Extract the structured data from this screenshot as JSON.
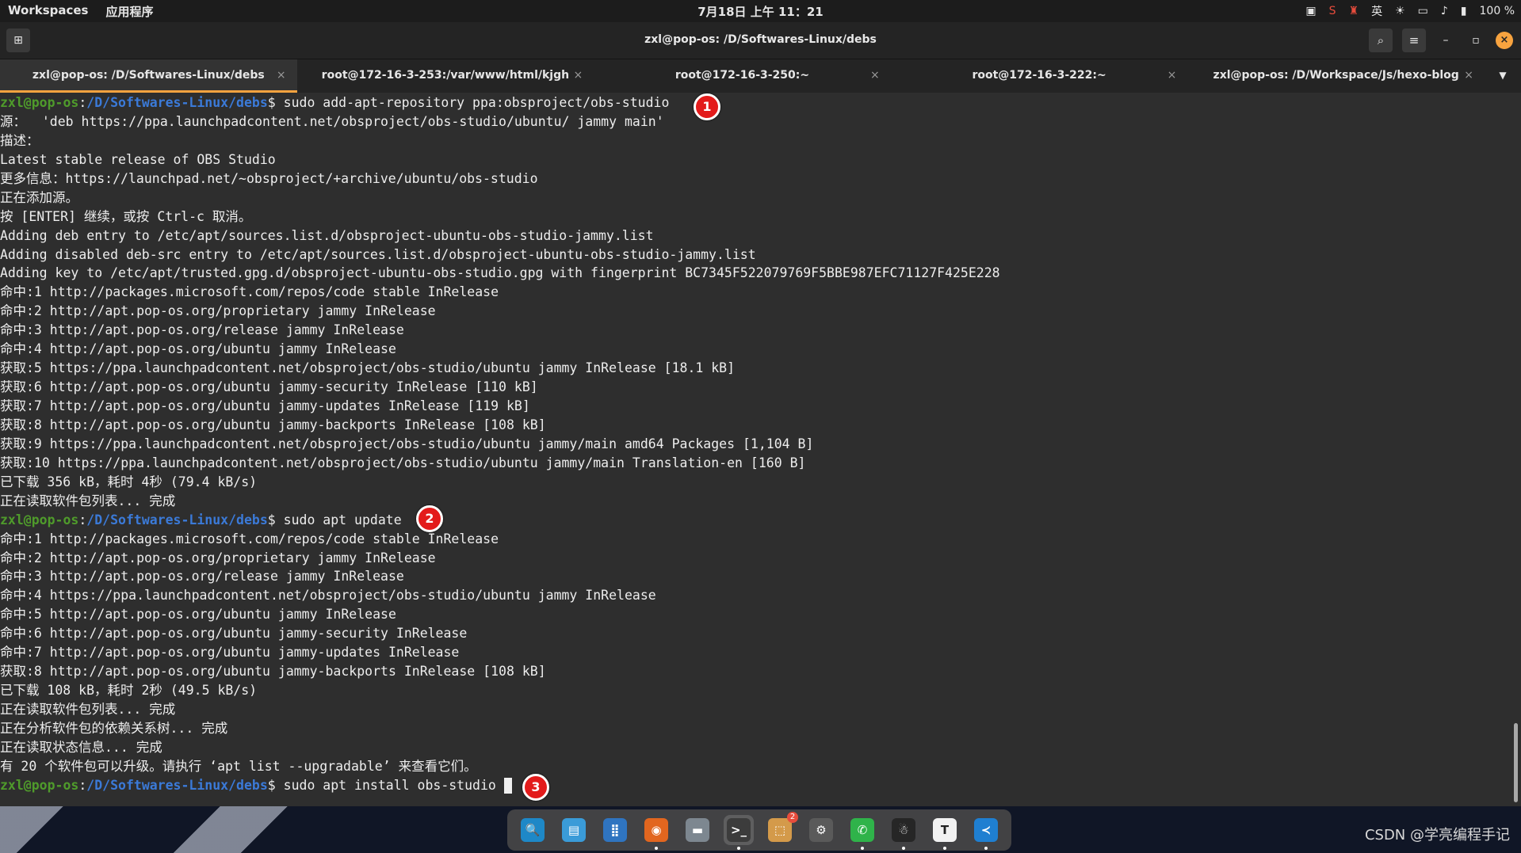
{
  "topbar": {
    "workspaces": "Workspaces",
    "apps": "应用程序",
    "clock": "7月18日 上午 11：21",
    "ime": "英",
    "battery": "100 %"
  },
  "window": {
    "title": "zxl@pop-os: /D/Softwares-Linux/debs"
  },
  "tabs": [
    {
      "label": "zxl@pop-os: /D/Softwares-Linux/debs",
      "active": true
    },
    {
      "label": "root@172-16-3-253:/var/www/html/kjgh",
      "active": false
    },
    {
      "label": "root@172-16-3-250:~",
      "active": false
    },
    {
      "label": "root@172-16-3-222:~",
      "active": false
    },
    {
      "label": "zxl@pop-os: /D/Workspace/Js/hexo-blog",
      "active": false
    }
  ],
  "prompt": {
    "user": "zxl@pop-os",
    "sep": ":",
    "path": "/D/Softwares-Linux/debs",
    "dollar": "$ "
  },
  "terminal": {
    "cmd1": "sudo add-apt-repository ppa:obsproject/obs-studio",
    "out1": [
      "源：  'deb https://ppa.launchpadcontent.net/obsproject/obs-studio/ubuntu/ jammy main'",
      "描述：",
      "Latest stable release of OBS Studio",
      "更多信息：https://launchpad.net/~obsproject/+archive/ubuntu/obs-studio",
      "正在添加源。",
      "按 [ENTER] 继续，或按 Ctrl-c 取消。",
      "Adding deb entry to /etc/apt/sources.list.d/obsproject-ubuntu-obs-studio-jammy.list",
      "Adding disabled deb-src entry to /etc/apt/sources.list.d/obsproject-ubuntu-obs-studio-jammy.list",
      "Adding key to /etc/apt/trusted.gpg.d/obsproject-ubuntu-obs-studio.gpg with fingerprint BC7345F522079769F5BBE987EFC71127F425E228",
      "命中:1 http://packages.microsoft.com/repos/code stable InRelease",
      "命中:2 http://apt.pop-os.org/proprietary jammy InRelease",
      "命中:3 http://apt.pop-os.org/release jammy InRelease",
      "命中:4 http://apt.pop-os.org/ubuntu jammy InRelease",
      "获取:5 https://ppa.launchpadcontent.net/obsproject/obs-studio/ubuntu jammy InRelease [18.1 kB]",
      "获取:6 http://apt.pop-os.org/ubuntu jammy-security InRelease [110 kB]",
      "获取:7 http://apt.pop-os.org/ubuntu jammy-updates InRelease [119 kB]",
      "获取:8 http://apt.pop-os.org/ubuntu jammy-backports InRelease [108 kB]",
      "获取:9 https://ppa.launchpadcontent.net/obsproject/obs-studio/ubuntu jammy/main amd64 Packages [1,104 B]",
      "获取:10 https://ppa.launchpadcontent.net/obsproject/obs-studio/ubuntu jammy/main Translation-en [160 B]",
      "已下载 356 kB，耗时 4秒 (79.4 kB/s)",
      "正在读取软件包列表... 完成"
    ],
    "cmd2": "sudo apt update",
    "out2": [
      "命中:1 http://packages.microsoft.com/repos/code stable InRelease",
      "命中:2 http://apt.pop-os.org/proprietary jammy InRelease",
      "命中:3 http://apt.pop-os.org/release jammy InRelease",
      "命中:4 https://ppa.launchpadcontent.net/obsproject/obs-studio/ubuntu jammy InRelease",
      "命中:5 http://apt.pop-os.org/ubuntu jammy InRelease",
      "命中:6 http://apt.pop-os.org/ubuntu jammy-security InRelease",
      "命中:7 http://apt.pop-os.org/ubuntu jammy-updates InRelease",
      "获取:8 http://apt.pop-os.org/ubuntu jammy-backports InRelease [108 kB]",
      "已下载 108 kB，耗时 2秒 (49.5 kB/s)",
      "正在读取软件包列表... 完成",
      "正在分析软件包的依赖关系树... 完成",
      "正在读取状态信息... 完成",
      "有 20 个软件包可以升级。请执行 ‘apt list --upgradable’ 来查看它们。"
    ],
    "cmd3": "sudo apt install obs-studio "
  },
  "badges": [
    "1",
    "2",
    "3"
  ],
  "dock": {
    "apps": [
      {
        "name": "search-app-icon",
        "glyph": "🔍",
        "bg": "#1e88c7"
      },
      {
        "name": "workspaces-app-icon",
        "glyph": "▤",
        "bg": "#3a9bd8"
      },
      {
        "name": "app-grid-icon",
        "glyph": "⣿",
        "bg": "#2f74c0"
      },
      {
        "name": "firefox-icon",
        "glyph": "◉",
        "bg": "#e2661f"
      },
      {
        "name": "files-icon",
        "glyph": "▬",
        "bg": "#7d8790"
      },
      {
        "name": "terminal-icon",
        "glyph": ">_",
        "bg": "#3c3c3c"
      },
      {
        "name": "app-store-icon",
        "glyph": "⬚",
        "bg": "#d49a4a"
      },
      {
        "name": "settings-icon",
        "glyph": "⚙",
        "bg": "#5a5a5a"
      },
      {
        "name": "wechat-icon",
        "glyph": "✆",
        "bg": "#2fb34a"
      },
      {
        "name": "qq-icon",
        "glyph": "☃",
        "bg": "#262626"
      },
      {
        "name": "typora-icon",
        "glyph": "T",
        "bg": "#f2f2f2"
      },
      {
        "name": "vscode-icon",
        "glyph": "≺",
        "bg": "#1f7fd1"
      }
    ],
    "app_store_notifications": "2"
  },
  "watermark": "CSDN @学亮编程手记",
  "colors": {
    "prompt_user": "#4f9b2b",
    "prompt_path": "#3b7ad8",
    "accent": "#f7a33f",
    "badge": "#e31b1b"
  }
}
